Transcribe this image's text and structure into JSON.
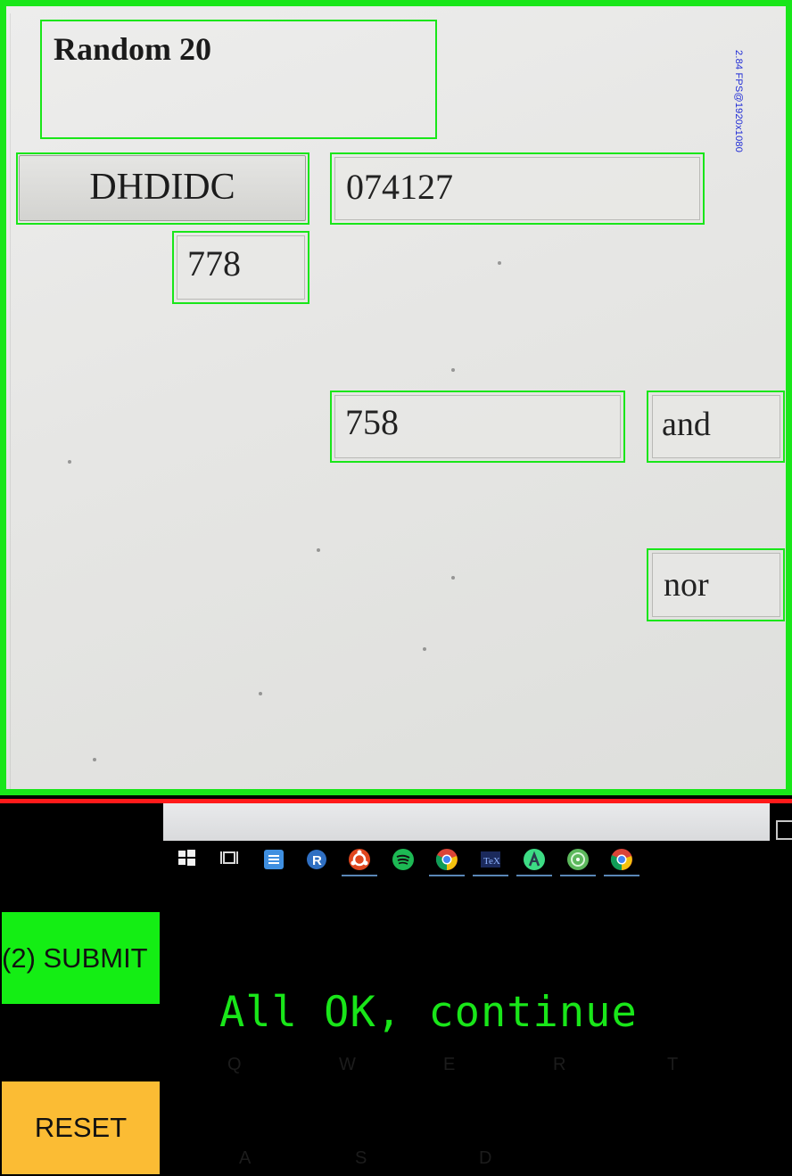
{
  "camera_view": {
    "fps_overlay": "2.84 FPS@1920x1080",
    "detections": {
      "title": "Random 20",
      "button_label": "DHDIDC",
      "code_field": "074127",
      "field_778": "778",
      "field_758": "758",
      "field_and": "and",
      "field_nor": "nor"
    }
  },
  "controls": {
    "submit_label": "(2) SUBMIT",
    "reset_label": "RESET"
  },
  "status": {
    "message": "All OK, continue"
  },
  "colors": {
    "detection_box": "#19e619",
    "scan_line": "#ff1a1a",
    "submit_bg": "#14ee14",
    "reset_bg": "#fbbc34",
    "status_text": "#19e619"
  },
  "taskbar_icons": [
    "windows-start-icon",
    "task-view-icon",
    "file-manager-icon",
    "r-language-icon",
    "ubuntu-icon",
    "spotify-icon",
    "chrome-icon",
    "tex-icon",
    "android-studio-icon",
    "xmind-icon",
    "chrome-icon"
  ]
}
